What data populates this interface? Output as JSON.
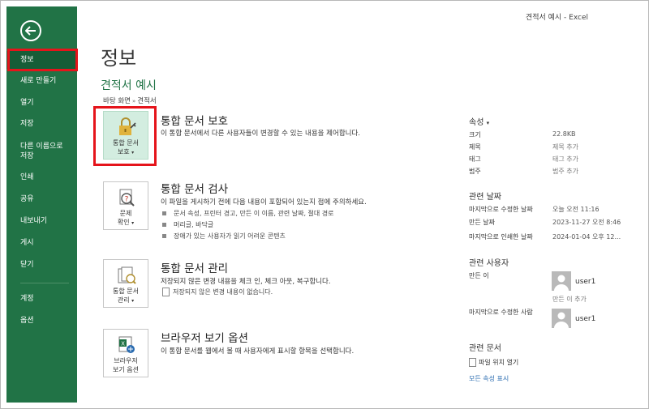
{
  "window": {
    "title": "견적서 예시 - Excel"
  },
  "sidebar": {
    "items": [
      {
        "label": "정보"
      },
      {
        "label": "새로 만들기"
      },
      {
        "label": "열기"
      },
      {
        "label": "저장"
      },
      {
        "label": "다른 이름으로 저장"
      },
      {
        "label": "인쇄"
      },
      {
        "label": "공유"
      },
      {
        "label": "내보내기"
      },
      {
        "label": "게시"
      },
      {
        "label": "닫기"
      },
      {
        "label": "계정"
      },
      {
        "label": "옵션"
      }
    ]
  },
  "main": {
    "title": "정보",
    "doc_name": "견적서 예시",
    "path": {
      "part1": "바탕 화면",
      "sep": "»",
      "part2": "견적서"
    },
    "sections": [
      {
        "button_line1": "통합 문서",
        "button_line2": "보호",
        "title": "통합 문서 보호",
        "desc": "이 통합 문서에서 다른 사용자들이 변경할 수 있는 내용을 제어합니다."
      },
      {
        "button_line1": "문제",
        "button_line2": "확인",
        "title": "통합 문서 검사",
        "desc": "이 파일을 게시하기 전에 다음 내용이 포함되어 있는지 점에 주의하세요.",
        "bullets": [
          "문서 속성, 프린터 경고, 만든 이 이름, 관련 날짜, 절대 경로",
          "머리글, 바닥글",
          "장애가 있는 사용자가 읽기 어려운 콘텐츠"
        ]
      },
      {
        "button_line1": "통합 문서",
        "button_line2": "관리",
        "title": "통합 문서 관리",
        "desc": "저장되지 않은 변경 내용을 체크 인, 체크 아웃, 복구합니다.",
        "sub": "저장되지 않은 변경 내용이 없습니다."
      },
      {
        "button_line1": "브라우저",
        "button_line2": "보기 옵션",
        "title": "브라우저 보기 옵션",
        "desc": "이 통합 문서를 웹에서 볼 때 사용자에게 표시할 항목을 선택합니다."
      }
    ]
  },
  "right": {
    "props_header": "속성",
    "props": [
      {
        "label": "크기",
        "value": "22.8KB"
      },
      {
        "label": "제목",
        "value": "제목 추가"
      },
      {
        "label": "태그",
        "value": "태그 추가"
      },
      {
        "label": "범주",
        "value": "범주 추가"
      }
    ],
    "dates_header": "관련 날짜",
    "dates": [
      {
        "label": "마지막으로 수정한 날짜",
        "value": "오늘 오전 11:16"
      },
      {
        "label": "만든 날짜",
        "value": "2023-11-27 오전 8:46"
      },
      {
        "label": "마지막으로 인쇄한 날짜",
        "value": "2024-01-04 오후 12..."
      }
    ],
    "people_header": "관련 사용자",
    "author_label": "만든 이",
    "author_name": "user1",
    "add_author": "만든 이 추가",
    "modifier_label": "마지막으로 수정한 사람",
    "modifier_name": "user1",
    "docs_header": "관련 문서",
    "open_location": "파일 위치 열기",
    "show_all": "모든 속성 표시"
  }
}
